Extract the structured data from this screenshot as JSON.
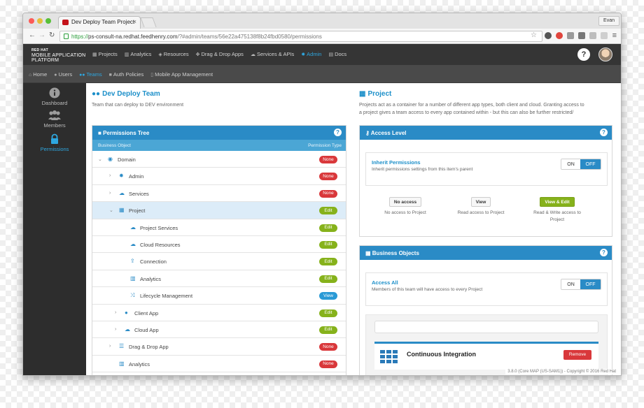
{
  "browser": {
    "tab_title": "Dev Deploy Team Project",
    "user": "Evan",
    "url_scheme": "https://",
    "url_host": "ps-consult-na.redhat.feedhenry.com",
    "url_path": "/?#admin/teams/56e22a475138f8b24fbd0580/permissions"
  },
  "brand": {
    "line1": "RED HAT",
    "line2": "MOBILE APPLICATION",
    "line3": "PLATFORM"
  },
  "topnav": {
    "items": [
      {
        "label": "Projects",
        "icon": "grid-icon"
      },
      {
        "label": "Analytics",
        "icon": "bar-chart-icon"
      },
      {
        "label": "Resources",
        "icon": "cube-icon"
      },
      {
        "label": "Drag & Drop Apps",
        "icon": "puzzle-icon"
      },
      {
        "label": "Services & APIs",
        "icon": "cloud-icon"
      },
      {
        "label": "Admin",
        "icon": "gear-icon",
        "active": true
      },
      {
        "label": "Docs",
        "icon": "book-icon"
      }
    ],
    "help": "?"
  },
  "subnav": {
    "items": [
      {
        "label": "Home",
        "icon": "home-icon"
      },
      {
        "label": "Users",
        "icon": "users-icon"
      },
      {
        "label": "Teams",
        "icon": "teams-icon",
        "active": true
      },
      {
        "label": "Auth Policies",
        "icon": "lock-icon"
      },
      {
        "label": "Mobile App Management",
        "icon": "mobile-icon"
      }
    ]
  },
  "sidebar": {
    "items": [
      {
        "label": "Dashboard",
        "icon": "info-icon"
      },
      {
        "label": "Members",
        "icon": "members-icon"
      },
      {
        "label": "Permissions",
        "icon": "padlock-icon",
        "active": true
      }
    ]
  },
  "team": {
    "title": "Dev Deploy Team",
    "description": "Team that can deploy to DEV environment"
  },
  "permissions_tree": {
    "title": "Permissions Tree",
    "col_object": "Business Object",
    "col_type": "Permission Type",
    "rows": [
      {
        "label": "Domain",
        "level": 0,
        "chevron": "down",
        "icon": "globe-icon",
        "glyph": "◉",
        "badge": "None",
        "badge_type": "none"
      },
      {
        "label": "Admin",
        "level": 1,
        "chevron": "right",
        "icon": "cog-icon",
        "glyph": "✹",
        "badge": "None",
        "badge_type": "none"
      },
      {
        "label": "Services",
        "level": 1,
        "chevron": "right",
        "icon": "cloud-up-icon",
        "glyph": "☁",
        "badge": "None",
        "badge_type": "none"
      },
      {
        "label": "Project",
        "level": 1,
        "chevron": "down",
        "icon": "grid-icon",
        "glyph": "▦",
        "badge": "Edit",
        "badge_type": "edit",
        "selected": true
      },
      {
        "label": "Project Services",
        "level": 2,
        "chevron": "",
        "icon": "cloud-up-icon",
        "glyph": "☁",
        "badge": "Edit",
        "badge_type": "edit"
      },
      {
        "label": "Cloud Resources",
        "level": 2,
        "chevron": "",
        "icon": "cloud-icon",
        "glyph": "☁",
        "badge": "Edit",
        "badge_type": "edit"
      },
      {
        "label": "Connection",
        "level": 2,
        "chevron": "",
        "icon": "upload-icon",
        "glyph": "⇪",
        "badge": "Edit",
        "badge_type": "edit"
      },
      {
        "label": "Analytics",
        "level": 2,
        "chevron": "",
        "icon": "bar-chart-icon",
        "glyph": "▥",
        "badge": "Edit",
        "badge_type": "edit"
      },
      {
        "label": "Lifecycle Management",
        "level": 2,
        "chevron": "",
        "icon": "shuffle-icon",
        "glyph": "⤨",
        "badge": "View",
        "badge_type": "view"
      },
      {
        "label": "Client App",
        "level": 1.5,
        "chevron": "right",
        "icon": "user-icon",
        "glyph": "●",
        "badge": "Edit",
        "badge_type": "edit"
      },
      {
        "label": "Cloud App",
        "level": 1.5,
        "chevron": "right",
        "icon": "cloud-icon",
        "glyph": "☁",
        "badge": "Edit",
        "badge_type": "edit"
      },
      {
        "label": "Drag & Drop App",
        "level": 1,
        "chevron": "right",
        "icon": "list-icon",
        "glyph": "☰",
        "badge": "None",
        "badge_type": "none"
      },
      {
        "label": "Analytics",
        "level": 1,
        "chevron": "",
        "icon": "bar-chart-icon",
        "glyph": "▥",
        "badge": "None",
        "badge_type": "none"
      }
    ]
  },
  "project": {
    "title": "Project",
    "desc1": "Projects act as a container for a number of different app types, both client and cloud. Granting access to",
    "desc2": "a project gives a team access to every app contained within - but this can also be further restricted/"
  },
  "access_level": {
    "title": "Access Level",
    "inherit_title": "Inherit Permissions",
    "inherit_desc": "Inherit permissions settings from this item's parent",
    "toggle_on": "ON",
    "toggle_off": "OFF",
    "levels": [
      {
        "button": "No access",
        "desc1": "No access to Project",
        "desc2": ""
      },
      {
        "button": "View",
        "desc1": "Read access to Project",
        "desc2": ""
      },
      {
        "button": "View & Edit",
        "desc1": "Read & Write access to",
        "desc2": "Project",
        "active": true
      }
    ]
  },
  "business_objects": {
    "title": "Business Objects",
    "access_all_title": "Access All",
    "access_all_desc": "Members of this team will have access to every Project",
    "toggle_on": "ON",
    "toggle_off": "OFF",
    "search_placeholder": "",
    "card_title": "Continuous Integration",
    "remove_label": "Remove"
  },
  "footer": "3.8.0 (Core MAP (US-SAM1)) - Copyright © 2016 Red Hat",
  "colors": {
    "accent": "#2a8bc6",
    "edit": "#86b21b",
    "none": "#d9383b",
    "view": "#2a9ad6",
    "nav_dark": "#353535"
  }
}
